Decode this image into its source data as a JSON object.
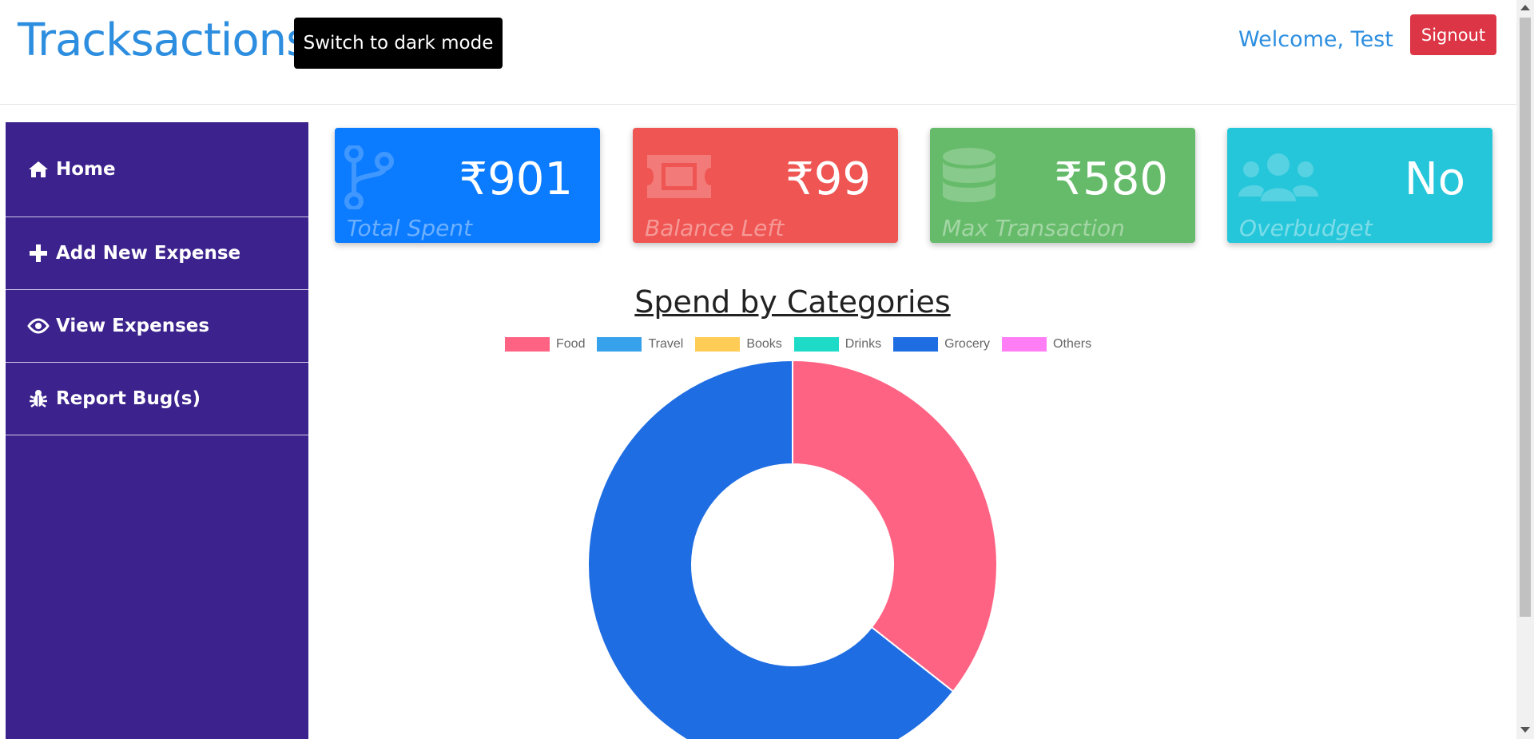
{
  "header": {
    "brand": "Tracksactions",
    "dark_mode_label": "Switch to dark mode",
    "welcome": "Welcome, Test",
    "signout_label": "Signout"
  },
  "sidebar": {
    "items": [
      {
        "label": "Home",
        "icon": "home-icon"
      },
      {
        "label": "Add New Expense",
        "icon": "plus-icon"
      },
      {
        "label": "View Expenses",
        "icon": "eye-icon"
      },
      {
        "label": "Report Bug(s)",
        "icon": "bug-icon"
      }
    ]
  },
  "cards": [
    {
      "value": "₹901",
      "label": "Total Spent",
      "icon": "code-branch-icon",
      "color": "#0b7bff"
    },
    {
      "value": "₹99",
      "label": "Balance Left",
      "icon": "ticket-icon",
      "color": "#ef5552"
    },
    {
      "value": "₹580",
      "label": "Max Transaction",
      "icon": "database-icon",
      "color": "#66bb6a"
    },
    {
      "value": "No",
      "label": "Overbudget",
      "icon": "users-icon",
      "color": "#26c6da"
    }
  ],
  "chart_data": {
    "type": "pie",
    "title": "Spend by Categories",
    "categories": [
      "Food",
      "Travel",
      "Books",
      "Drinks",
      "Grocery",
      "Others"
    ],
    "values": [
      321,
      0,
      0,
      0,
      580,
      0
    ],
    "colors": [
      "#ff6384",
      "#36a2eb",
      "#ffcd56",
      "#1ddbc6",
      "#1f6de2",
      "#ff7ef5"
    ],
    "legend_position": "top"
  }
}
